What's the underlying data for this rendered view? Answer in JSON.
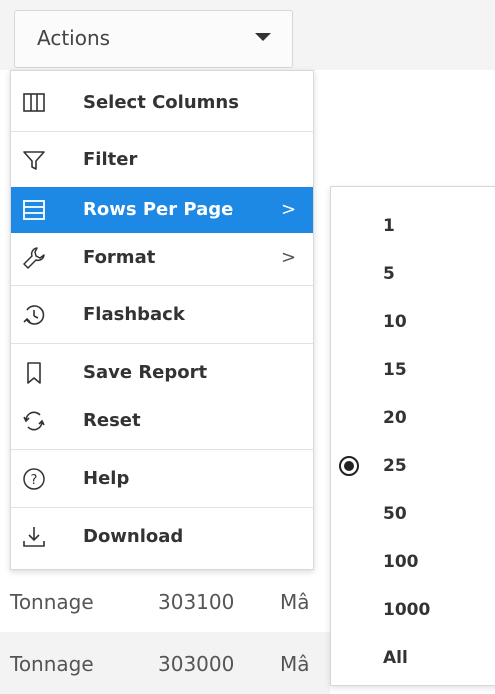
{
  "actions_button": {
    "label": "Actions"
  },
  "menu": {
    "items": [
      {
        "label": "Select Columns",
        "icon": "columns-icon"
      },
      {
        "label": "Filter",
        "icon": "filter-icon"
      },
      {
        "label": "Rows Per Page",
        "icon": "rows-icon",
        "submenu_arrow": ">",
        "active": true
      },
      {
        "label": "Format",
        "icon": "wrench-icon",
        "submenu_arrow": ">"
      },
      {
        "label": "Flashback",
        "icon": "flashback-icon"
      },
      {
        "label": "Save Report",
        "icon": "bookmark-icon"
      },
      {
        "label": "Reset",
        "icon": "reset-icon"
      },
      {
        "label": "Help",
        "icon": "help-icon"
      },
      {
        "label": "Download",
        "icon": "download-icon"
      }
    ]
  },
  "rows_per_page": {
    "options": [
      "1",
      "5",
      "10",
      "15",
      "20",
      "25",
      "50",
      "100",
      "1000",
      "All"
    ],
    "selected": "25"
  },
  "table_rows": [
    {
      "c1": "Tonnage",
      "c2": "303100",
      "c3": "Mâ"
    },
    {
      "c1": "Tonnage",
      "c2": "303000",
      "c3": "Mâ"
    }
  ],
  "colors": {
    "accent": "#1e88e5"
  }
}
